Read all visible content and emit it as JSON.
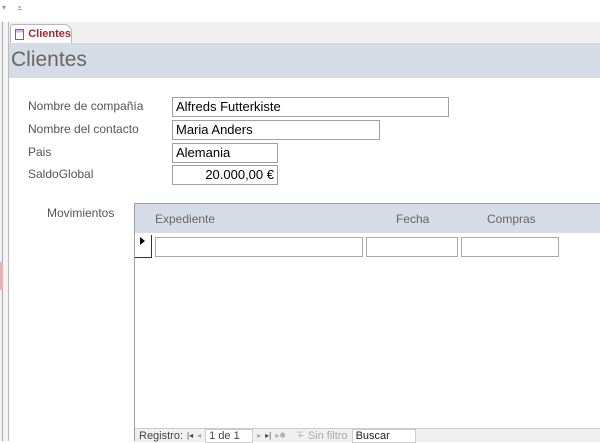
{
  "window": {
    "qat_arrow": "▾",
    "qat_more": "⩡"
  },
  "tab": {
    "label": "Clientes",
    "icon": "form-icon"
  },
  "form": {
    "title": "Clientes",
    "fields": [
      {
        "label": "Nombre de compañía",
        "value": "Alfreds Futterkiste"
      },
      {
        "label": "Nombre del contacto",
        "value": "Maria Anders"
      },
      {
        "label": "Pais",
        "value": "Alemania"
      },
      {
        "label": "SaldoGlobal",
        "value": "20.000,00 €"
      }
    ],
    "subform": {
      "label": "Movimientos",
      "columns": [
        "Expediente",
        "Fecha",
        "Compras"
      ],
      "rows": [
        [
          "",
          "",
          ""
        ]
      ]
    }
  },
  "navigation": {
    "record_label": "Registro:",
    "first": "|◂",
    "prev": "◂",
    "current": "1 de 1",
    "next": "▸",
    "last": "▸|",
    "new": "▸✱",
    "filter_icon": "⊤̶",
    "filter_label": "Sin filtro",
    "search_placeholder": "Buscar"
  }
}
